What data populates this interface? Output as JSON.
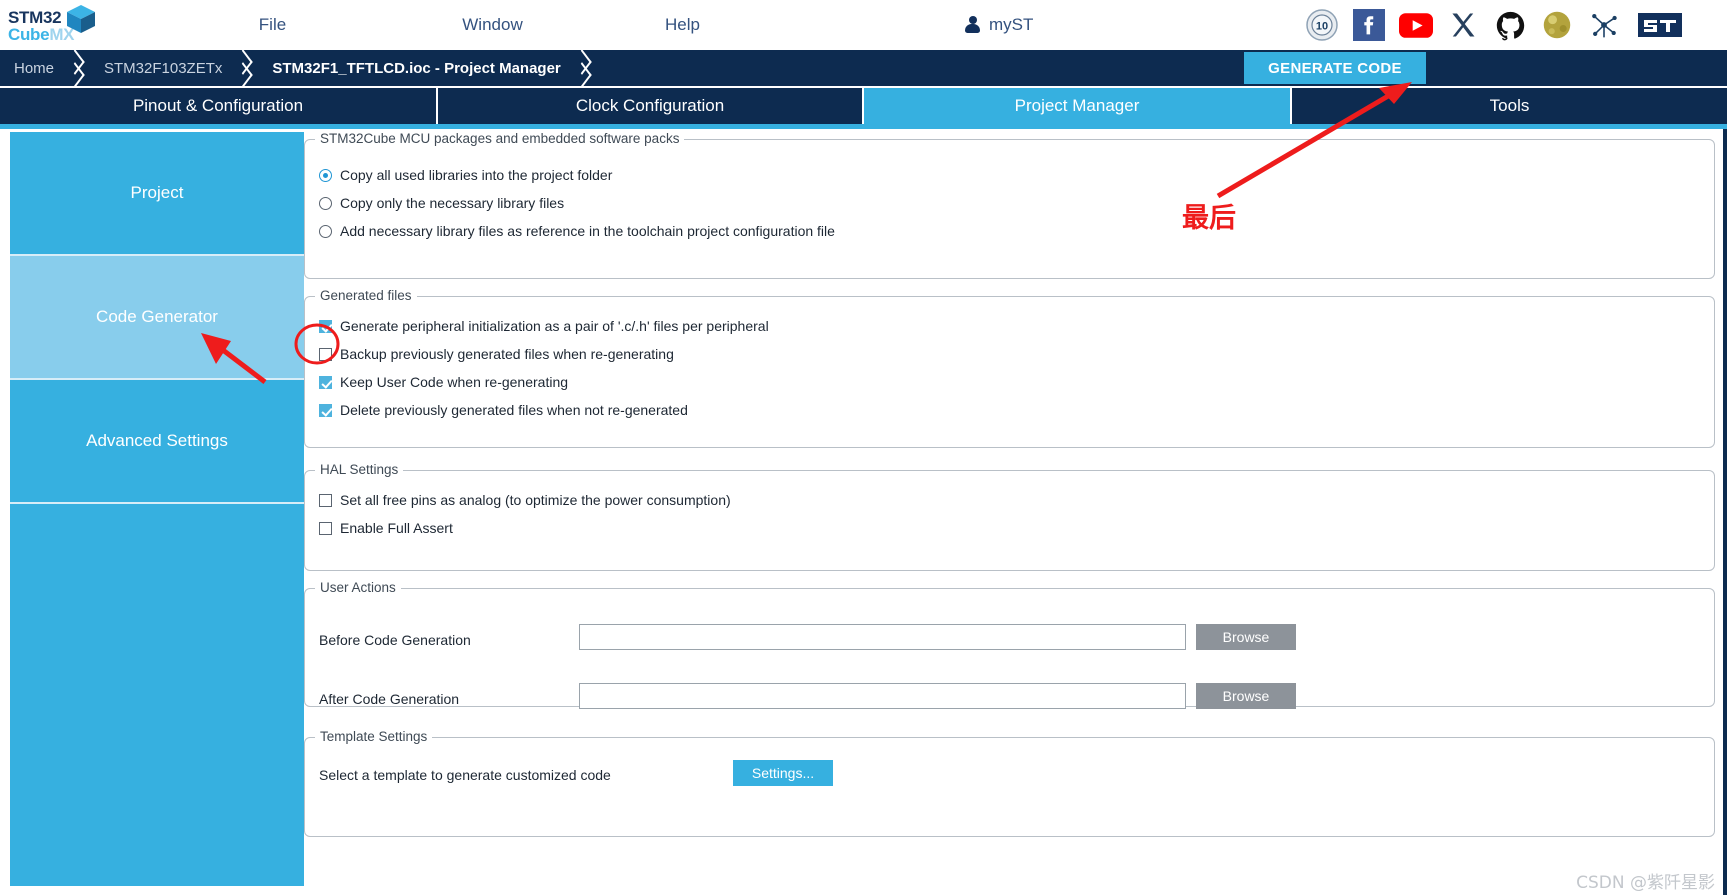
{
  "app": {
    "logo_line1_bold": "STM32",
    "logo_line1_light": "",
    "logo_line2_bold": "Cube",
    "logo_line2_light": "MX"
  },
  "menubar": {
    "items": [
      {
        "label": "File"
      },
      {
        "label": "Window"
      },
      {
        "label": "Help"
      }
    ],
    "account_label": "myST",
    "account_icon": "person-icon",
    "social_icons": [
      {
        "name": "st-community-badge-icon",
        "label": "10"
      },
      {
        "name": "facebook-icon",
        "label": "f"
      },
      {
        "name": "youtube-icon",
        "label": ""
      },
      {
        "name": "x-twitter-icon",
        "label": "X"
      },
      {
        "name": "github-icon",
        "label": ""
      },
      {
        "name": "wiki-globe-icon",
        "label": ""
      },
      {
        "name": "network-nodes-icon",
        "label": ""
      },
      {
        "name": "st-logo-icon",
        "label": ""
      }
    ]
  },
  "breadcrumb": {
    "items": [
      {
        "label": "Home",
        "active": false
      },
      {
        "label": "STM32F103ZETx",
        "active": false
      },
      {
        "label": "STM32F1_TFTLCD.ioc - Project Manager",
        "active": true
      }
    ],
    "generate_code_label": "GENERATE CODE"
  },
  "tabs": [
    {
      "label": "Pinout & Configuration",
      "active": false
    },
    {
      "label": "Clock Configuration",
      "active": false
    },
    {
      "label": "Project Manager",
      "active": true
    },
    {
      "label": "Tools",
      "active": false
    }
  ],
  "sidebar": {
    "items": [
      {
        "label": "Project",
        "active": false
      },
      {
        "label": "Code Generator",
        "active": true
      },
      {
        "label": "Advanced Settings",
        "active": false
      }
    ]
  },
  "groups": {
    "packages": {
      "legend": "STM32Cube MCU packages and embedded software packs",
      "options": [
        {
          "label": "Copy all used libraries into the project folder",
          "selected": true
        },
        {
          "label": "Copy only the necessary library files",
          "selected": false
        },
        {
          "label": "Add necessary library files as reference in the toolchain project configuration file",
          "selected": false
        }
      ]
    },
    "generated_files": {
      "legend": "Generated files",
      "options": [
        {
          "label": "Generate peripheral initialization as a pair of '.c/.h' files per peripheral",
          "checked": true
        },
        {
          "label": "Backup previously generated files when re-generating",
          "checked": false
        },
        {
          "label": "Keep User Code when re-generating",
          "checked": true
        },
        {
          "label": "Delete previously generated files when not re-generated",
          "checked": true
        }
      ]
    },
    "hal_settings": {
      "legend": "HAL Settings",
      "options": [
        {
          "label": "Set all free pins as analog (to optimize the power consumption)",
          "checked": false
        },
        {
          "label": "Enable Full Assert",
          "checked": false
        }
      ]
    },
    "user_actions": {
      "legend": "User Actions",
      "rows": [
        {
          "label": "Before Code Generation",
          "value": "",
          "placeholder": "",
          "button": "Browse"
        },
        {
          "label": "After Code Generation",
          "value": "",
          "placeholder": "",
          "button": "Browse"
        }
      ]
    },
    "template_settings": {
      "legend": "Template Settings",
      "description": "Select a template to generate customized code",
      "button": "Settings..."
    }
  },
  "annotations": {
    "final_step_text": "最后",
    "arrow_color": "#ee1c1c",
    "highlight_circle_color": "#ee1c1c"
  },
  "watermark": "CSDN @紫阡星影",
  "colors": {
    "navy": "#0d2b50",
    "accent_blue": "#36b0e0",
    "sidebar_active": "#88cdec",
    "menu_text": "#34527f"
  }
}
